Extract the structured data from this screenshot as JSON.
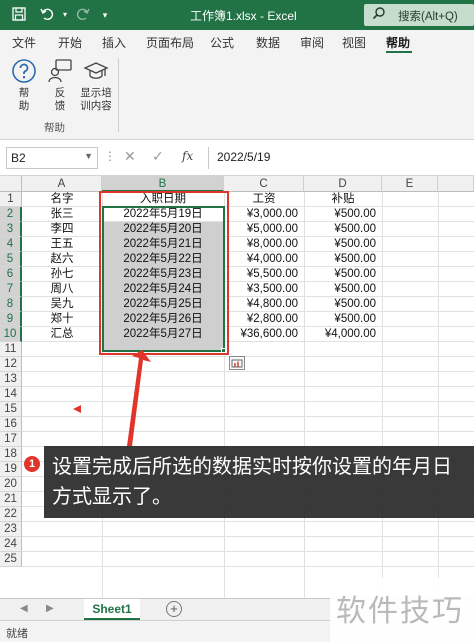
{
  "window": {
    "title": "工作簿1.xlsx  -  Excel",
    "search_label": "搜索(Alt+Q)"
  },
  "ribbon": {
    "tabs": [
      "文件",
      "开始",
      "插入",
      "页面布局",
      "公式",
      "数据",
      "审阅",
      "视图",
      "帮助"
    ],
    "active_tab": "帮助",
    "buttons": {
      "help": [
        "帮",
        "助"
      ],
      "feedback": [
        "反",
        "馈"
      ],
      "training": [
        "显示培",
        "训内容"
      ]
    },
    "group_label": "帮助"
  },
  "formula_bar": {
    "name_box": "B2",
    "fx": "fx",
    "value": "2022/5/19"
  },
  "grid": {
    "columns": [
      "A",
      "B",
      "C",
      "D",
      "E"
    ],
    "rows": [
      "1",
      "2",
      "3",
      "4",
      "5",
      "6",
      "7",
      "8",
      "9",
      "10",
      "11",
      "12",
      "13",
      "14",
      "15",
      "16",
      "17",
      "18",
      "19",
      "20",
      "21",
      "22",
      "23",
      "24",
      "25"
    ],
    "header_row": [
      "名字",
      "入职日期",
      "工资",
      "补贴"
    ],
    "data": [
      [
        "张三",
        "2022年5月19日",
        "¥3,000.00",
        "¥500.00"
      ],
      [
        "李四",
        "2022年5月20日",
        "¥5,000.00",
        "¥500.00"
      ],
      [
        "王五",
        "2022年5月21日",
        "¥8,000.00",
        "¥500.00"
      ],
      [
        "赵六",
        "2022年5月22日",
        "¥4,000.00",
        "¥500.00"
      ],
      [
        "孙七",
        "2022年5月23日",
        "¥5,500.00",
        "¥500.00"
      ],
      [
        "周八",
        "2022年5月24日",
        "¥3,500.00",
        "¥500.00"
      ],
      [
        "吴九",
        "2022年5月25日",
        "¥4,800.00",
        "¥500.00"
      ],
      [
        "郑十",
        "2022年5月26日",
        "¥2,800.00",
        "¥500.00"
      ],
      [
        "汇总",
        "2022年5月27日",
        "¥36,600.00",
        "¥4,000.00"
      ]
    ]
  },
  "annotation": {
    "number": "1",
    "text": "设置完成后所选的数据实时按你设置的年月日方式显示了。"
  },
  "sheets": {
    "tabs": [
      "Sheet1"
    ],
    "add": "+"
  },
  "status": {
    "text": "就绪"
  },
  "watermark": "软件技巧",
  "colors": {
    "excel_green": "#217346",
    "highlight_red": "#e0352b",
    "selection_gray": "#cfcfcf"
  },
  "icons": {
    "save": "save-icon",
    "undo": "undo-icon",
    "redo": "redo-icon",
    "help": "help-circle-icon",
    "feedback": "feedback-person-icon",
    "training": "graduation-cap-icon",
    "search": "search-icon",
    "quick_analysis": "quick-analysis-icon"
  }
}
